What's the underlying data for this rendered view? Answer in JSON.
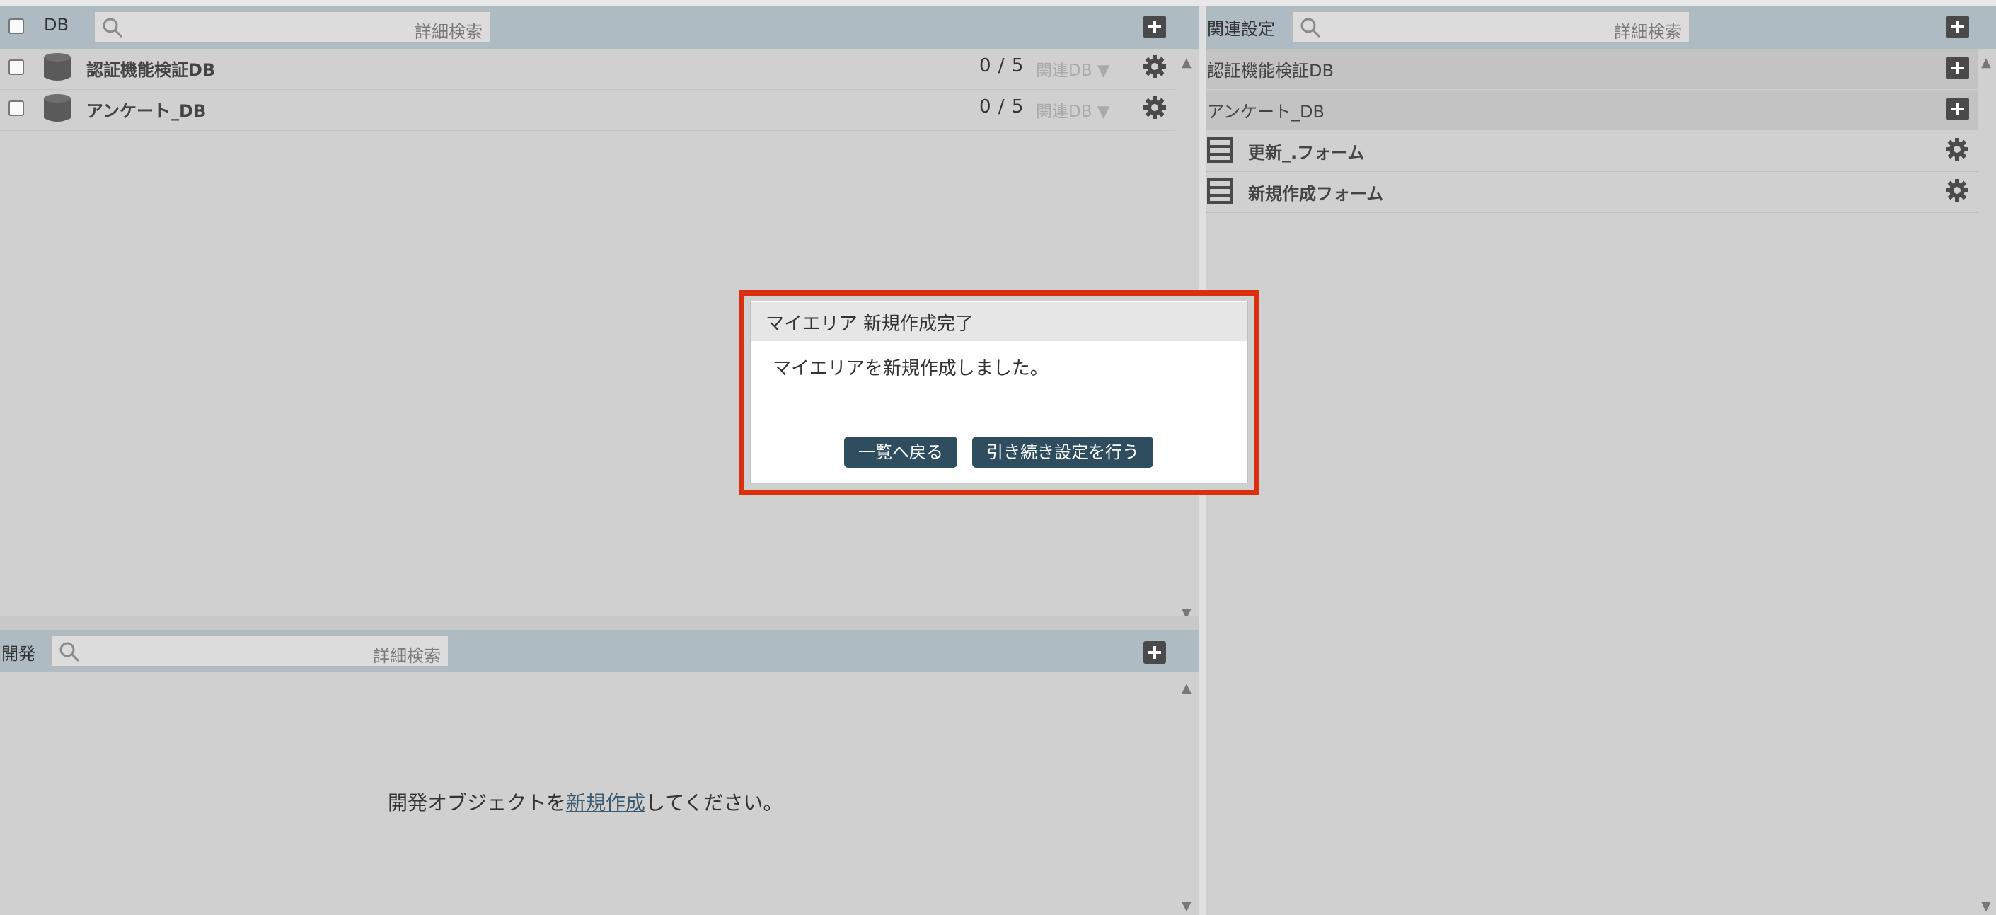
{
  "db_panel": {
    "title": "DB",
    "search_placeholder": "詳細検索",
    "rows": [
      {
        "name": "認証機能検証DB",
        "count": "0 / 5",
        "related": "関連DB ▼"
      },
      {
        "name": "アンケート_DB",
        "count": "0 / 5",
        "related": "関連DB ▼"
      }
    ]
  },
  "related_panel": {
    "title": "関連設定",
    "search_placeholder": "詳細検索",
    "groups": [
      "認証機能検証DB",
      "アンケート_DB"
    ],
    "forms": [
      "更新_.フォーム",
      "新規作成フォーム"
    ]
  },
  "dev_panel": {
    "title": "開発",
    "search_placeholder": "詳細検索",
    "empty_prefix": "開発オブジェクトを",
    "empty_link": "新規作成",
    "empty_suffix": "してください。"
  },
  "dialog": {
    "title": "マイエリア 新規作成完了",
    "message": "マイエリアを新規作成しました。",
    "back_label": "一覧へ戻る",
    "continue_label": "引き続き設定を行う"
  },
  "colors": {
    "header_bar": "#aebbc3",
    "button_dark": "#2e4d5e",
    "highlight_border": "#d93010"
  },
  "icons": {
    "search": "search-icon",
    "plus": "plus-icon",
    "gear": "gear-icon",
    "database": "database-icon",
    "form": "form-list-icon"
  }
}
